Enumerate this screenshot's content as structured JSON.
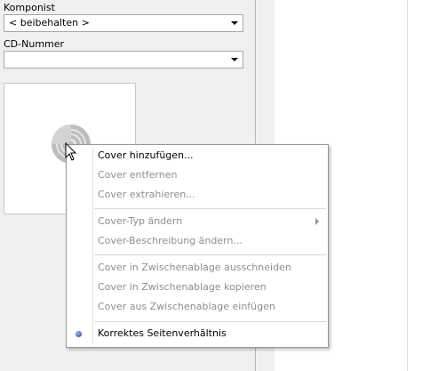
{
  "form": {
    "composer_label": "Komponist",
    "composer_value": "< beibehalten >",
    "cd_number_label": "CD-Nummer",
    "cd_number_value": ""
  },
  "context_menu": {
    "items": [
      {
        "label": "Cover hinzufügen...",
        "enabled": true
      },
      {
        "label": "Cover entfernen",
        "enabled": false
      },
      {
        "label": "Cover extrahieren...",
        "enabled": false
      },
      {
        "label": "Cover-Typ ändern",
        "enabled": false,
        "submenu": true
      },
      {
        "label": "Cover-Beschreibung ändern...",
        "enabled": false
      },
      {
        "label": "Cover in Zwischenablage ausschneiden",
        "enabled": false
      },
      {
        "label": "Cover in Zwischenablage kopieren",
        "enabled": false
      },
      {
        "label": "Cover aus Zwischenablage einfügen",
        "enabled": false
      },
      {
        "label": "Korrektes Seitenverhältnis",
        "enabled": true,
        "checked": true
      }
    ]
  },
  "icons": {
    "cover_placeholder": "cd-disc-icon",
    "cursor": "mouse-pointer-icon",
    "dropdown": "chevron-down-icon",
    "submenu": "chevron-right-icon"
  }
}
